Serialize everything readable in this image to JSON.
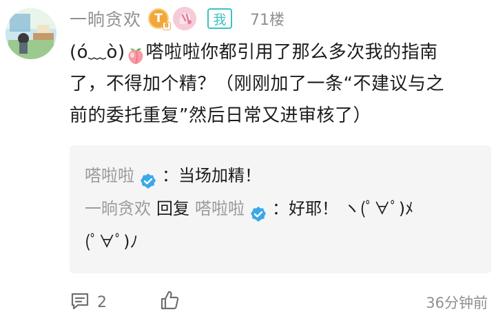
{
  "post": {
    "username": "一晌贪欢",
    "level_badge_letter": "T",
    "level_badge_num": "8",
    "me_tag": "我",
    "floor": "71楼",
    "content": {
      "line1_prefix": "(ó﹏ò)",
      "line1_rest": "嗒啦啦你都引用了那么多次我的指南",
      "line2": "了，不得加个精？（刚刚加了一条“不建议与之",
      "line3": "前的委托重复”然后日常又进审核了）"
    },
    "quote": {
      "replies": [
        {
          "author": "嗒啦啦",
          "text": "：当场加精！"
        },
        {
          "author": "一晌贪欢",
          "reply_word": "回复",
          "target": "嗒啦啦",
          "text": "：好耶！ ヽ(ﾟ∀ﾟ)ﾒ",
          "text_cont": "(ﾟ∀ﾟ)ﾉ"
        }
      ]
    },
    "footer": {
      "comment_count": "2",
      "time": "36分钟前"
    }
  },
  "colors": {
    "accent_teal": "#3cc0c4",
    "verify_blue": "#3aa8e8",
    "meta_gray": "#8f8f8f",
    "quote_bg": "#f5f5f5"
  }
}
